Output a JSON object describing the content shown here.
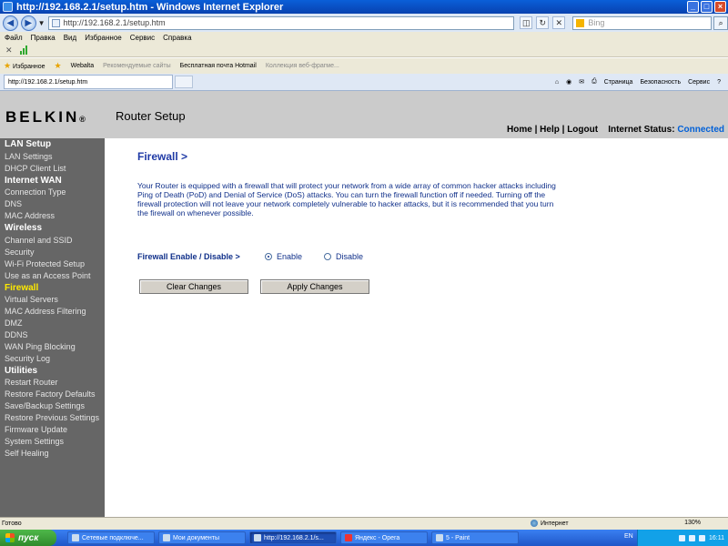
{
  "window": {
    "title": "http://192.168.2.1/setup.htm - Windows Internet Explorer",
    "buttons": {
      "minimize": "_",
      "maximize": "□",
      "close": "×"
    }
  },
  "address": {
    "url": "http://192.168.2.1/setup.htm",
    "search_placeholder": "Bing"
  },
  "menu": [
    "Файл",
    "Правка",
    "Вид",
    "Избранное",
    "Сервис",
    "Справка"
  ],
  "favorites": {
    "label": "Избранное",
    "items": [
      "Webalta",
      "Рекомендуемые сайты",
      "Бесплатная почта Hotmail",
      "Коллекция веб-фрагме..."
    ]
  },
  "tab": {
    "label": "http://192.168.2.1/setup.htm"
  },
  "commandbar": {
    "page": "Страница",
    "safety": "Безопасность",
    "tools": "Сервис"
  },
  "header": {
    "logo": "BELKIN",
    "logo_mark": "®",
    "title": "Router Setup",
    "links": "Home | Help | Logout",
    "status_label": "Internet Status:",
    "status_value": "Connected",
    "status_color": "#0060d8"
  },
  "sidebar": [
    {
      "label": "LAN Setup",
      "kind": "heading"
    },
    {
      "label": "LAN Settings",
      "kind": "item"
    },
    {
      "label": "DHCP Client List",
      "kind": "item"
    },
    {
      "label": "Internet WAN",
      "kind": "heading"
    },
    {
      "label": "Connection Type",
      "kind": "item"
    },
    {
      "label": "DNS",
      "kind": "item"
    },
    {
      "label": "MAC Address",
      "kind": "item"
    },
    {
      "label": "Wireless",
      "kind": "heading"
    },
    {
      "label": "Channel and SSID",
      "kind": "item"
    },
    {
      "label": "Security",
      "kind": "item"
    },
    {
      "label": "Wi-Fi Protected Setup",
      "kind": "item"
    },
    {
      "label": "Use as an Access Point",
      "kind": "item"
    },
    {
      "label": "Firewall",
      "kind": "active"
    },
    {
      "label": "Virtual Servers",
      "kind": "item"
    },
    {
      "label": "MAC Address Filtering",
      "kind": "item"
    },
    {
      "label": "DMZ",
      "kind": "item"
    },
    {
      "label": "DDNS",
      "kind": "item"
    },
    {
      "label": "WAN Ping Blocking",
      "kind": "item"
    },
    {
      "label": "Security Log",
      "kind": "item"
    },
    {
      "label": "Utilities",
      "kind": "heading"
    },
    {
      "label": "Restart Router",
      "kind": "item"
    },
    {
      "label": "Restore Factory Defaults",
      "kind": "item"
    },
    {
      "label": "Save/Backup Settings",
      "kind": "item"
    },
    {
      "label": "Restore Previous Settings",
      "kind": "item"
    },
    {
      "label": "Firmware Update",
      "kind": "item"
    },
    {
      "label": "System Settings",
      "kind": "item"
    },
    {
      "label": "Self Healing",
      "kind": "item"
    }
  ],
  "content": {
    "title": "Firewall >",
    "description": "Your Router is equipped with a firewall that will protect your network from a wide array of common hacker attacks including Ping of Death (PoD) and Denial of Service (DoS) attacks. You can turn the firewall function off if needed. Turning off the firewall protection will not leave your network completely vulnerable to hacker attacks, but it is recommended that you turn the firewall on whenever possible.",
    "firewall_label": "Firewall Enable / Disable >",
    "enable_label": "Enable",
    "disable_label": "Disable",
    "selected": "Enable",
    "clear_button": "Clear Changes",
    "apply_button": "Apply Changes"
  },
  "statusbar": {
    "left": "Готово",
    "zone": "Интернет",
    "zoom": "130%"
  },
  "taskbar": {
    "start": "пуск",
    "tasks": [
      "Сетевые подключе...",
      "Мои документы",
      "http://192.168.2.1/s...",
      "Яндекс - Opera",
      "5 - Paint"
    ],
    "active_index": 2,
    "lang": "EN",
    "clock": "16:11"
  }
}
